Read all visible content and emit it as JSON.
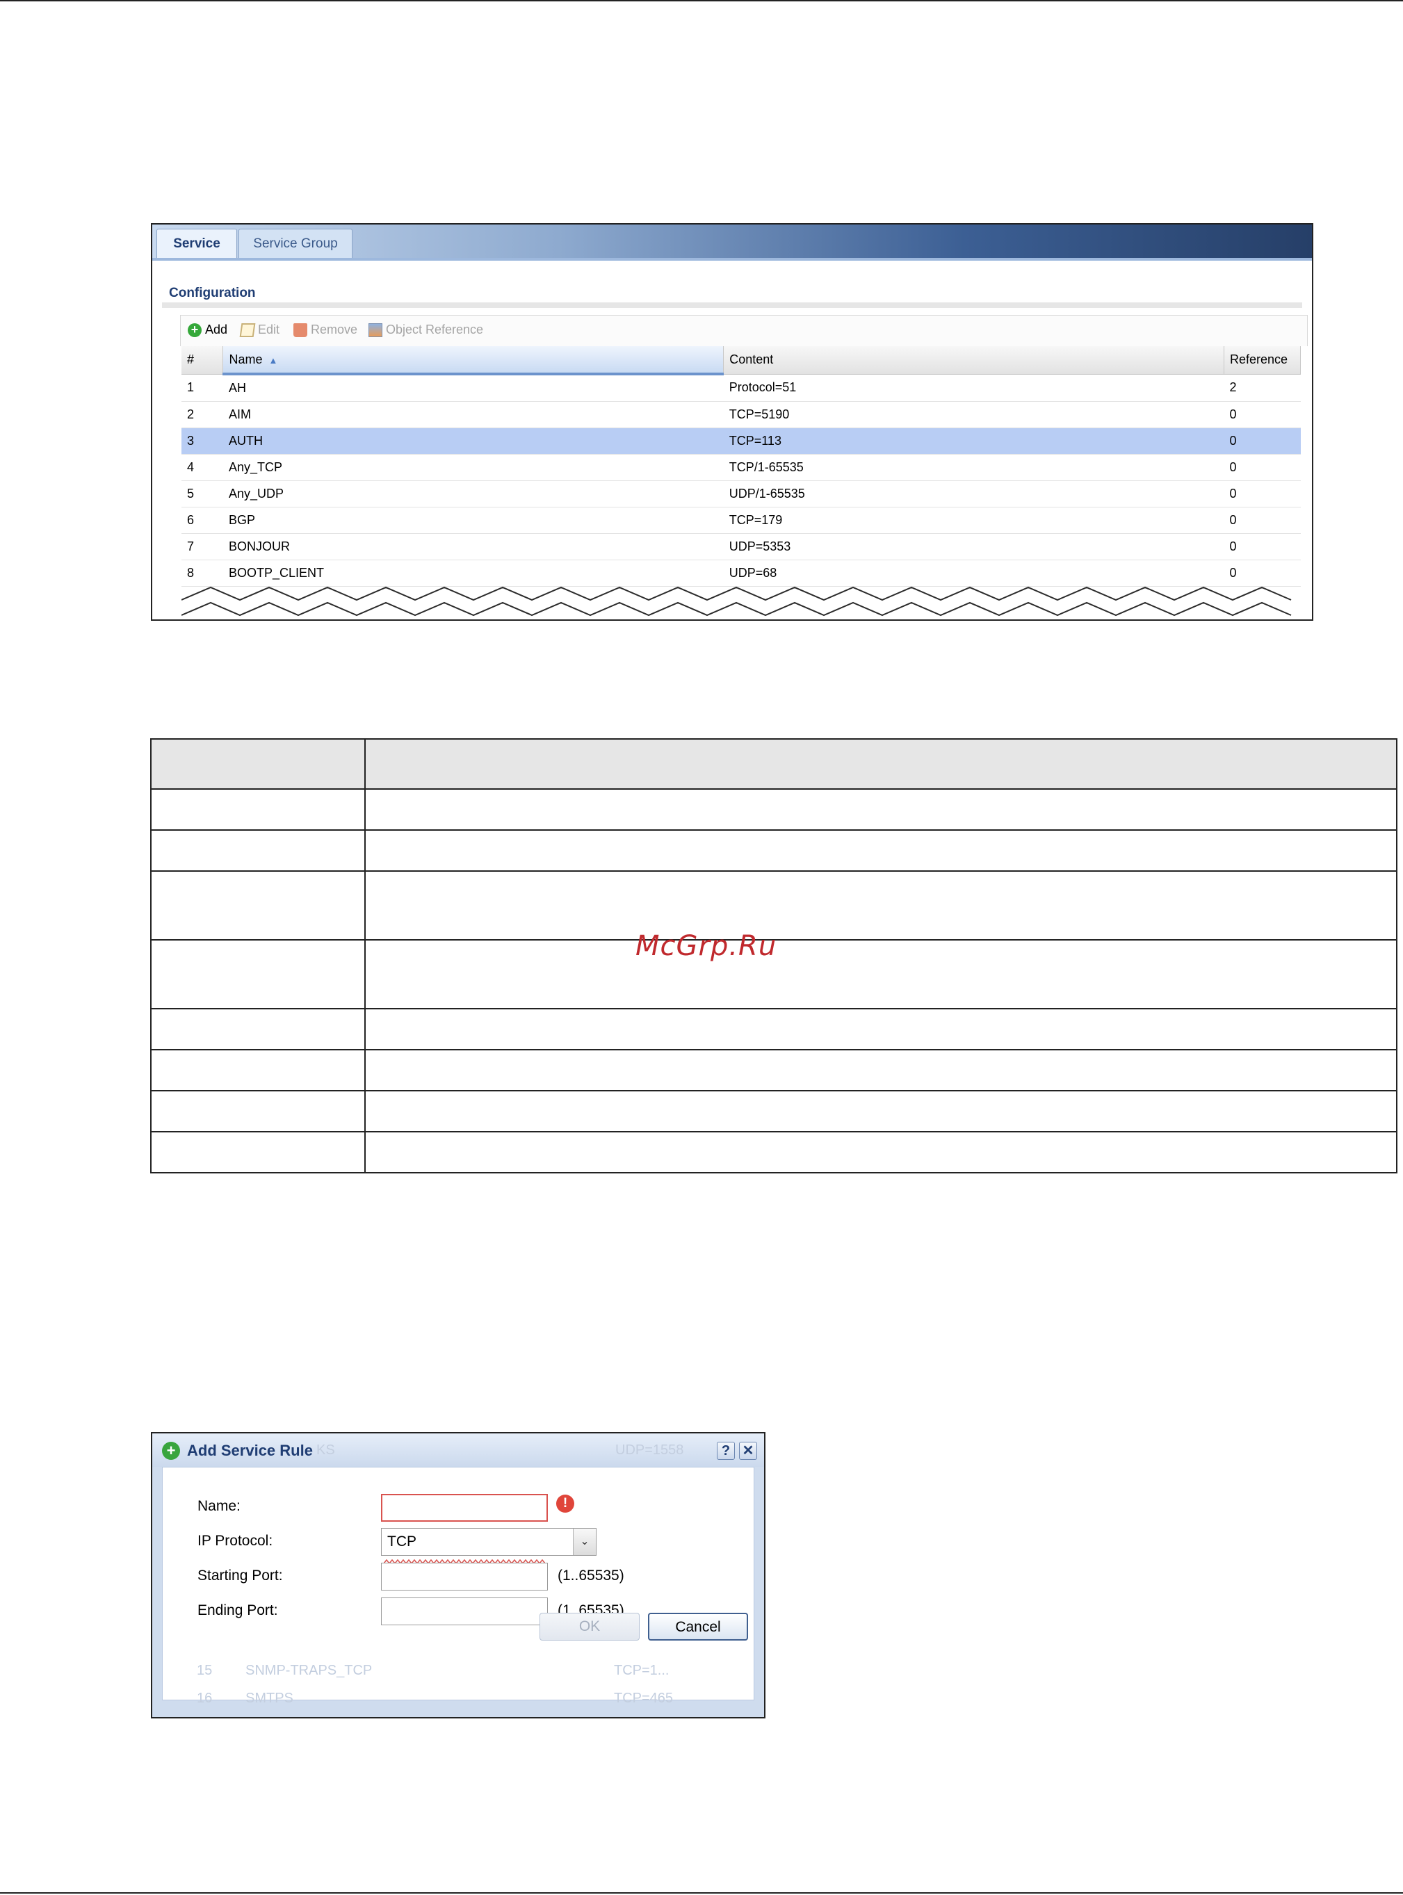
{
  "service_screen": {
    "tabs": [
      {
        "label": "Service",
        "active": true
      },
      {
        "label": "Service Group",
        "active": false
      }
    ],
    "section_title": "Configuration",
    "toolbar": {
      "add": "Add",
      "edit": "Edit",
      "remove": "Remove",
      "object_reference": "Object Reference"
    },
    "columns": [
      "#",
      "Name",
      "Content",
      "Reference"
    ],
    "rows": [
      {
        "num": "1",
        "name": "AH",
        "content": "Protocol=51",
        "reference": "2"
      },
      {
        "num": "2",
        "name": "AIM",
        "content": "TCP=5190",
        "reference": "0"
      },
      {
        "num": "3",
        "name": "AUTH",
        "content": "TCP=113",
        "reference": "0",
        "selected": true
      },
      {
        "num": "4",
        "name": "Any_TCP",
        "content": "TCP/1-65535",
        "reference": "0"
      },
      {
        "num": "5",
        "name": "Any_UDP",
        "content": "UDP/1-65535",
        "reference": "0"
      },
      {
        "num": "6",
        "name": "BGP",
        "content": "TCP=179",
        "reference": "0"
      },
      {
        "num": "7",
        "name": "BONJOUR",
        "content": "UDP=5353",
        "reference": "0"
      },
      {
        "num": "8",
        "name": "BOOTP_CLIENT",
        "content": "UDP=68",
        "reference": "0"
      }
    ],
    "colors": {
      "selected_row": "#b8cdf4",
      "section_title": "#1f3d73"
    }
  },
  "watermark": "McGrp.Ru",
  "dialog": {
    "title": "Add Service Rule",
    "help_icon": "?",
    "close_icon": "✕",
    "add_icon": "+",
    "error_icon": "!",
    "background_ghost": {
      "title_suffix": "KS",
      "title_value": "UDP=1558",
      "rows": [
        {
          "num": "15",
          "name": "SNMP-TRAPS_TCP",
          "content": "TCP=1..."
        },
        {
          "num": "16",
          "name": "SMTPS",
          "content": "TCP=465"
        }
      ]
    },
    "fields": {
      "name_label": "Name:",
      "name_value": "",
      "ip_protocol_label": "IP Protocol:",
      "ip_protocol_value": "TCP",
      "starting_port_label": "Starting Port:",
      "starting_port_value": "",
      "starting_port_range": "(1..65535)",
      "ending_port_label": "Ending Port:",
      "ending_port_value": "",
      "ending_port_range": "(1..65535)"
    },
    "buttons": {
      "ok": "OK",
      "cancel": "Cancel"
    }
  }
}
